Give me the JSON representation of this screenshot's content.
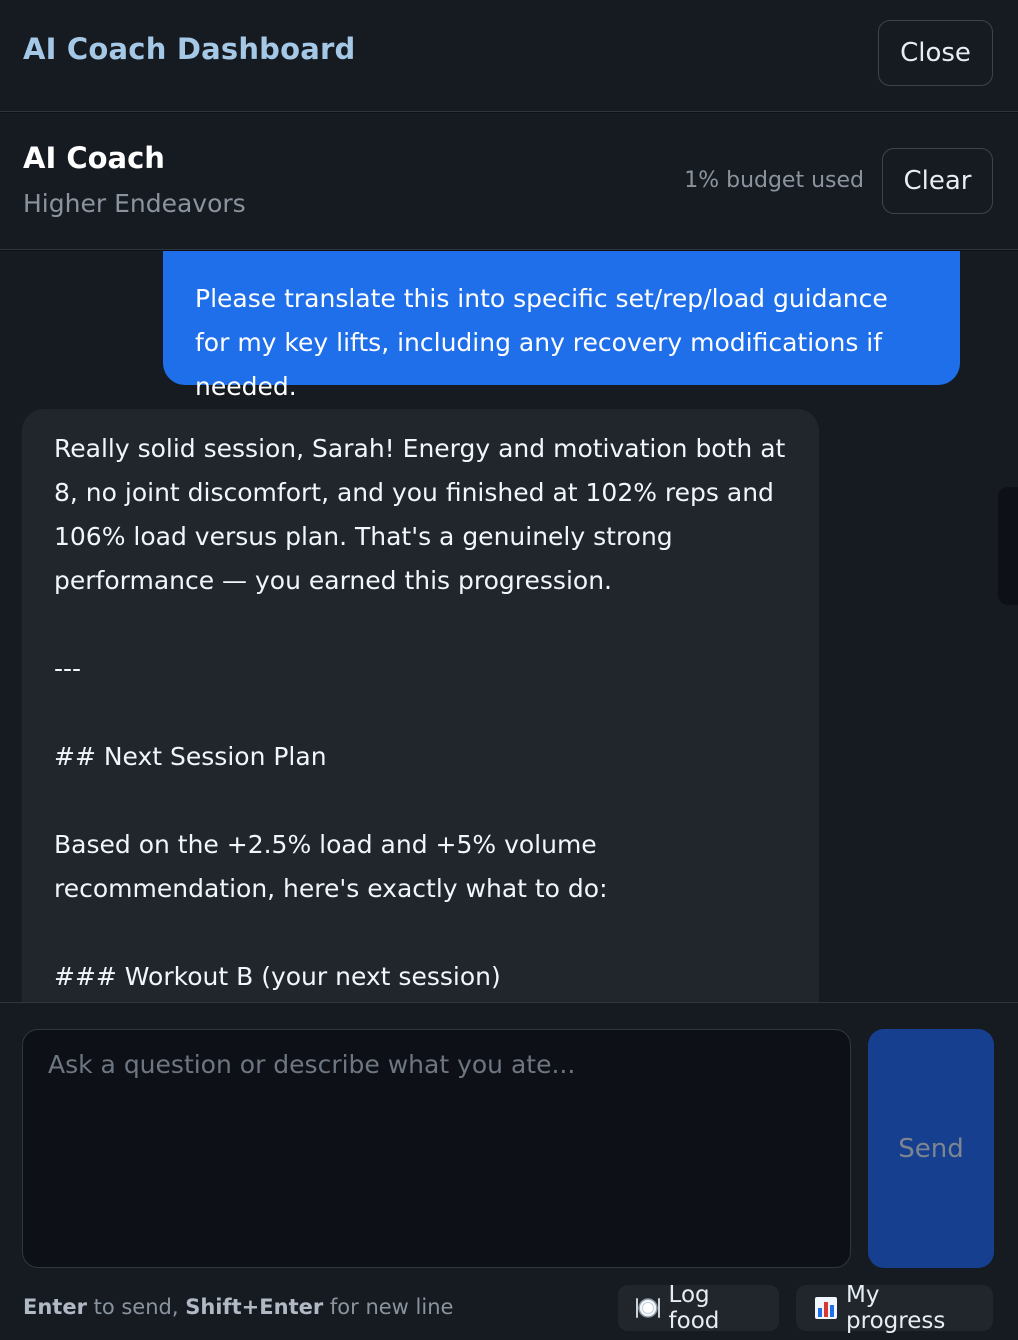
{
  "topbar": {
    "title": "AI Coach Dashboard",
    "close_label": "Close"
  },
  "coach": {
    "name": "AI Coach",
    "subtitle": "Higher Endeavors",
    "budget": "1% budget used",
    "clear_label": "Clear"
  },
  "messages": {
    "user": "Please translate this into specific set/rep/load guidance for my key lifts, including any recovery modifications if needed.",
    "assistant": [
      "Really solid session, Sarah! Energy and motivation both at 8, no joint discomfort, and you finished at 102% reps and 106% load versus plan. That's a genuinely strong performance — you earned this progression.",
      "---",
      "## Next Session Plan",
      "Based on the +2.5% load and +5% volume recommendation, here's exactly what to do:",
      "### Workout B (your next session)"
    ]
  },
  "composer": {
    "placeholder": "Ask a question or describe what you ate...",
    "send_label": "Send",
    "hint_key1": "Enter",
    "hint_text1": " to send, ",
    "hint_key2": "Shift+Enter",
    "hint_text2": " for new line",
    "log_food_label": "Log food",
    "my_progress_label": "My progress"
  },
  "icons": {
    "log_food": "plate-icon",
    "my_progress": "bar-chart-icon"
  },
  "colors": {
    "accent": "#1f6feb",
    "title": "#a5c8e6",
    "send_button": "#163f8f"
  }
}
